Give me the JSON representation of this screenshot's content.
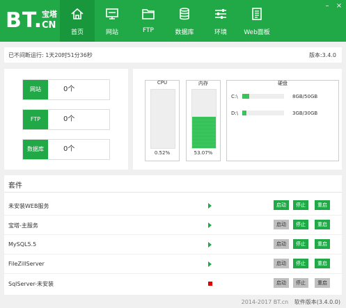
{
  "app": {
    "logo_main": "BT.",
    "logo_cn_top": "宝塔",
    "logo_cn_bottom": "CN",
    "colors": {
      "brand": "#21a847",
      "brand_dark": "#18973c",
      "stop": "#e10000",
      "disabled": "#bfbfbf"
    }
  },
  "nav": [
    {
      "label": "首页",
      "icon": "home-icon",
      "active": true
    },
    {
      "label": "网站",
      "icon": "monitor-icon"
    },
    {
      "label": "FTP",
      "icon": "folder-icon"
    },
    {
      "label": "数据库",
      "icon": "database-icon"
    },
    {
      "label": "环境",
      "icon": "sliders-icon"
    },
    {
      "label": "Web面板",
      "icon": "document-icon"
    }
  ],
  "window_controls": {
    "minimize": "–",
    "close": "×"
  },
  "status": {
    "uptime": "已不间断运行: 1天20时51分36秒",
    "version": "版本:3.4.0"
  },
  "counts": [
    {
      "label": "网站",
      "value": "0个"
    },
    {
      "label": "FTP",
      "value": "0个"
    },
    {
      "label": "数据库",
      "value": "0个"
    }
  ],
  "meters": {
    "cpu": {
      "title": "CPU",
      "percent_text": "0.52%",
      "percent": 0.52
    },
    "memory": {
      "title": "内存",
      "percent_text": "53.07%",
      "percent": 53.07
    }
  },
  "disk": {
    "title": "硬盘",
    "drives": [
      {
        "name": "C:\\",
        "size": "8GB/50GB",
        "fraction": 0.16
      },
      {
        "name": "D:\\",
        "size": "3GB/30GB",
        "fraction": 0.1
      }
    ]
  },
  "plugins": {
    "title": "套件",
    "start_label": "启动",
    "stop_label": "停止",
    "restart_label": "重启",
    "items": [
      {
        "name": "未安装WEB服务",
        "state": "run",
        "start_enabled": true,
        "stop_enabled": true
      },
      {
        "name": "宝塔-主服务",
        "state": "run",
        "start_enabled": false,
        "stop_enabled": true
      },
      {
        "name": "MySQL5.5",
        "state": "run",
        "start_enabled": false,
        "stop_enabled": true
      },
      {
        "name": "FileZillServer",
        "state": "run",
        "start_enabled": false,
        "stop_enabled": true
      },
      {
        "name": "SqlServer-未安装",
        "state": "stop",
        "start_enabled": false,
        "stop_enabled": false
      }
    ]
  },
  "footer": {
    "copyright": "2014-2017 BT.cn",
    "version": "软件版本(3.4.0.0)"
  }
}
